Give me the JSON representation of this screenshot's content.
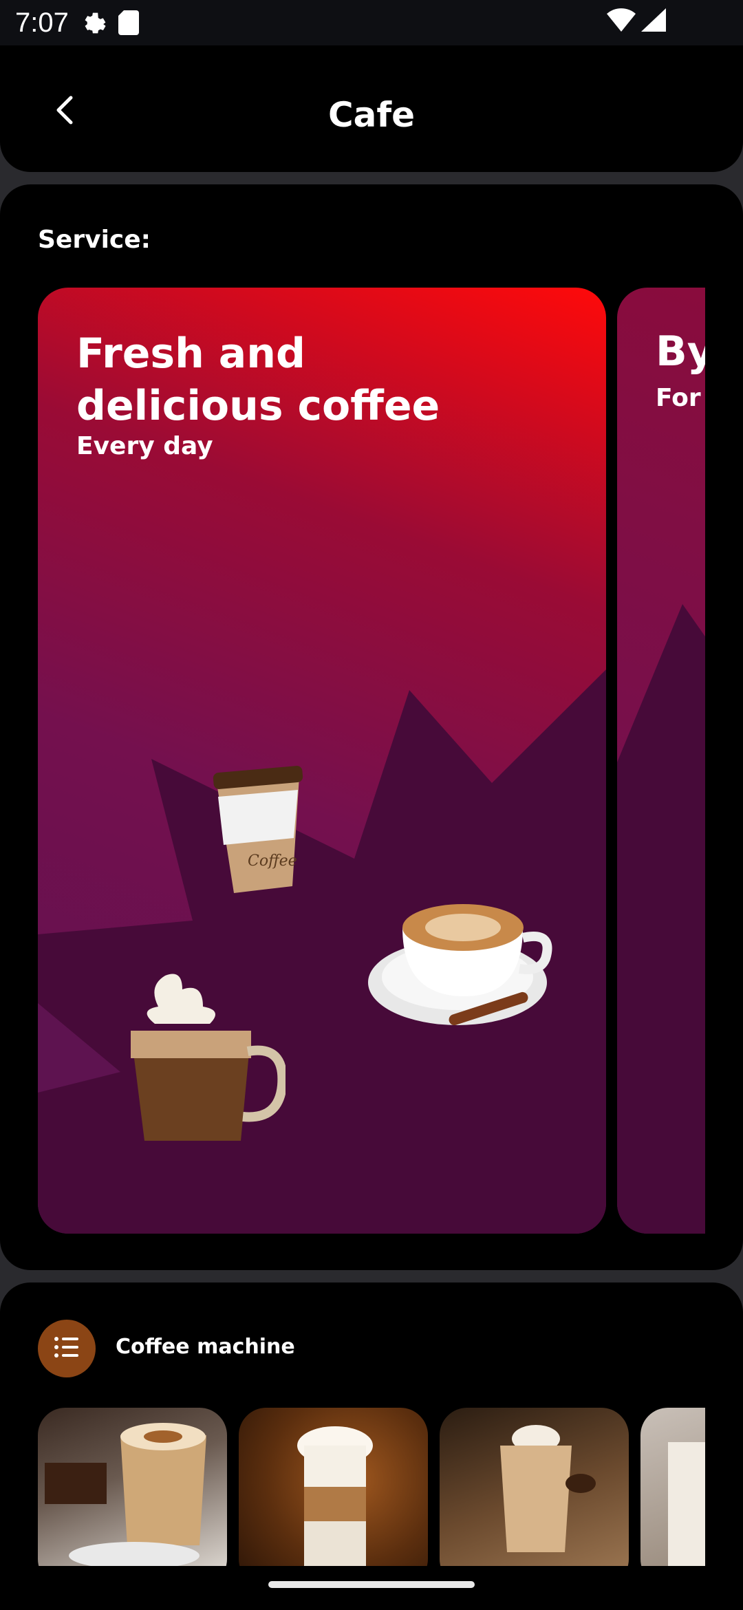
{
  "status_bar": {
    "time": "7:07"
  },
  "header": {
    "title": "Cafe"
  },
  "service": {
    "label": "Service:",
    "banners": [
      {
        "title": "Fresh and\ndelicious coffee",
        "subtitle": "Every day"
      },
      {
        "title": "By",
        "subtitle": "For"
      }
    ]
  },
  "machine": {
    "label": "Coffee machine"
  },
  "icons": {
    "back": "chevron-left-icon",
    "settings": "gear-icon",
    "sd_card": "sd-card-icon",
    "wifi": "wifi-icon",
    "signal": "signal-icon",
    "list": "list-icon"
  },
  "colors": {
    "background": "#000000",
    "accent": "#8b4515",
    "banner_red": "#ff0a0a",
    "banner_purple": "#5a1250"
  }
}
